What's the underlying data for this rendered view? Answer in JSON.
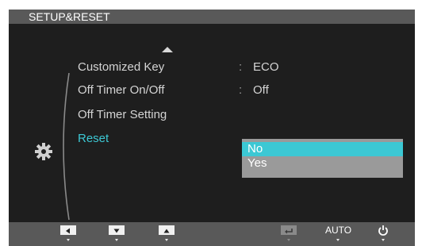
{
  "header": {
    "title": "SETUP&RESET"
  },
  "menu": {
    "items": [
      {
        "label": "Customized Key",
        "value": "ECO",
        "separator": ":"
      },
      {
        "label": "Off Timer On/Off",
        "value": "Off",
        "separator": ":"
      },
      {
        "label": "Off Timer Setting"
      },
      {
        "label": "Reset",
        "active": true
      }
    ],
    "category_icon": "gear-icon"
  },
  "dropdown": {
    "options": [
      {
        "label": "No",
        "selected": true
      },
      {
        "label": "Yes",
        "selected": false
      }
    ]
  },
  "bottom_bar": {
    "keys": [
      {
        "name": "left-arrow-key",
        "icon": "left-triangle-icon"
      },
      {
        "name": "down-arrow-key",
        "icon": "down-triangle-icon"
      },
      {
        "name": "up-arrow-key",
        "icon": "up-triangle-icon"
      },
      {
        "name": "enter-key",
        "icon": "enter-icon",
        "dimmed": true
      },
      {
        "name": "auto-key",
        "label": "AUTO"
      },
      {
        "name": "power-key",
        "icon": "power-icon"
      }
    ]
  },
  "colors": {
    "accent": "#3cc8d4",
    "header_bg": "#595959",
    "body_bg": "#1e1e1e",
    "dropdown_bg": "#9a9a9a"
  }
}
